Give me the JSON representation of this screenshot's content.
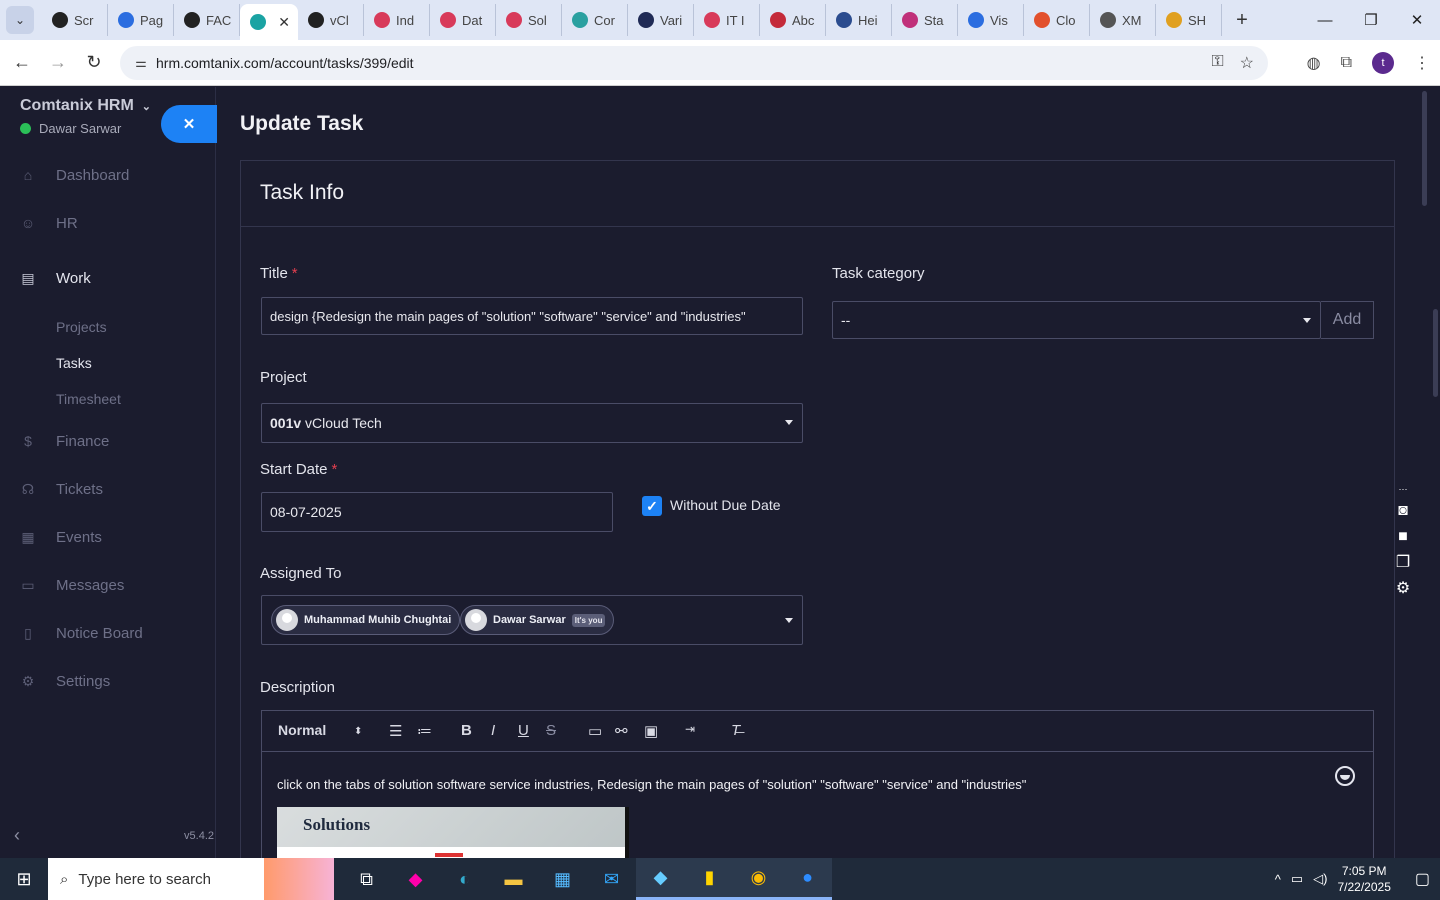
{
  "browser": {
    "tabs": [
      {
        "label": "Scr",
        "color": "#222222"
      },
      {
        "label": "Pag",
        "color": "#2b6de0"
      },
      {
        "label": "FAC",
        "color": "#222222"
      },
      {
        "label": "",
        "color": "#1aa3a3",
        "active": true
      },
      {
        "label": "vCl",
        "color": "#222222"
      },
      {
        "label": "Ind",
        "color": "#d83a5a"
      },
      {
        "label": "Dat",
        "color": "#d83a5a"
      },
      {
        "label": "Sol",
        "color": "#d83a5a"
      },
      {
        "label": "Cor",
        "color": "#2aa0a0"
      },
      {
        "label": "Vari",
        "color": "#1f2a55"
      },
      {
        "label": "IT I",
        "color": "#d83a5a"
      },
      {
        "label": "Abc",
        "color": "#c42a3a"
      },
      {
        "label": "Hei",
        "color": "#2b4c8f"
      },
      {
        "label": "Sta",
        "color": "#c0307a"
      },
      {
        "label": "Vis",
        "color": "#2b6de0"
      },
      {
        "label": "Clo",
        "color": "#e2502c"
      },
      {
        "label": "XM",
        "color": "#555555"
      },
      {
        "label": "SH",
        "color": "#e0a020"
      }
    ],
    "url": "hrm.comtanix.com/account/tasks/399/edit",
    "profile_initial": "t"
  },
  "sidebar": {
    "brand": "Comtanix HRM",
    "user": "Dawar Sarwar",
    "menu": [
      {
        "label": "Dashboard",
        "icon": "home-icon",
        "glyph": "⌂"
      },
      {
        "label": "HR",
        "icon": "people-icon",
        "glyph": "☺"
      },
      {
        "label": "Work",
        "icon": "briefcase-icon",
        "glyph": "▤",
        "active": true
      }
    ],
    "submenu": [
      {
        "label": "Projects"
      },
      {
        "label": "Tasks",
        "active": true
      },
      {
        "label": "Timesheet"
      }
    ],
    "menu2": [
      {
        "label": "Finance",
        "icon": "dollar-icon",
        "glyph": "$"
      },
      {
        "label": "Tickets",
        "icon": "headset-icon",
        "glyph": "☊"
      },
      {
        "label": "Events",
        "icon": "calendar-icon",
        "glyph": "▦"
      },
      {
        "label": "Messages",
        "icon": "chat-icon",
        "glyph": "▭"
      },
      {
        "label": "Notice Board",
        "icon": "clipboard-icon",
        "glyph": "▯"
      },
      {
        "label": "Settings",
        "icon": "gear-icon",
        "glyph": "⚙"
      }
    ],
    "version": "v5.4.2"
  },
  "page": {
    "title": "Update Task",
    "card_title": "Task Info"
  },
  "form": {
    "title_label": "Title",
    "title_value": "design {Redesign the main pages of \"solution\" \"software\" \"service\" and \"industries\"",
    "category_label": "Task category",
    "category_value": "--",
    "add_label": "Add",
    "project_label": "Project",
    "project_code": "001v",
    "project_name": "vCloud Tech",
    "start_label": "Start Date",
    "start_value": "08-07-2025",
    "due_label": "Without Due Date",
    "assigned_label": "Assigned To",
    "assignees": [
      {
        "name": "Muhammad Muhib Chughtai"
      },
      {
        "name": "Dawar Sarwar",
        "badge": "It's you"
      }
    ],
    "description_label": "Description",
    "editor_format": "Normal",
    "description_text": "click on the tabs of solution software service industries, Redesign the main pages of \"solution\" \"software\" \"service\" and \"industries\"",
    "image_caption": "Solutions"
  },
  "taskbar": {
    "search_placeholder": "Type here to search",
    "time": "7:05 PM",
    "date": "7/22/2025"
  }
}
